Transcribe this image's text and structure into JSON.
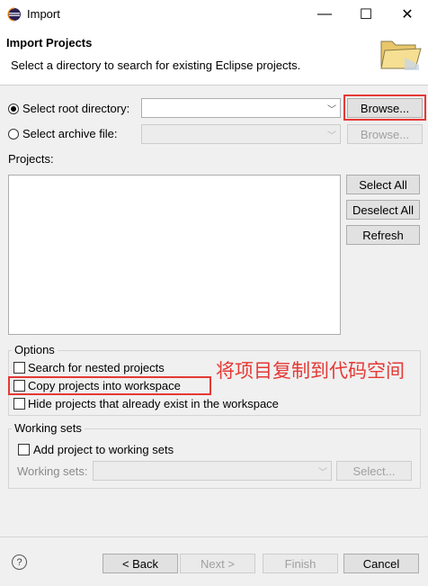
{
  "window": {
    "title": "Import",
    "minimize_glyph": "—",
    "maximize_glyph": "☐",
    "close_glyph": "✕"
  },
  "header": {
    "title": "Import Projects",
    "description": "Select a directory to search for existing Eclipse projects."
  },
  "source": {
    "root_dir_label": "Select root directory:",
    "root_dir_value": "",
    "archive_label": "Select archive file:",
    "archive_value": "",
    "browse_label": "Browse...",
    "browse_archive_label": "Browse..."
  },
  "projects": {
    "label": "Projects:",
    "items": [],
    "select_all": "Select All",
    "deselect_all": "Deselect All",
    "refresh": "Refresh"
  },
  "options": {
    "title": "Options",
    "search_nested": "Search for nested projects",
    "copy_into_workspace": "Copy projects into workspace",
    "hide_existing": "Hide projects that already exist in the workspace"
  },
  "annotation": {
    "text": "将项目复制到代码空间"
  },
  "working_sets": {
    "title": "Working sets",
    "add_label": "Add project to working sets",
    "sets_label": "Working sets:",
    "sets_value": "",
    "select_label": "Select..."
  },
  "footer": {
    "help": "?",
    "back": "< Back",
    "next": "Next >",
    "finish": "Finish",
    "cancel": "Cancel"
  },
  "colors": {
    "annotation_red": "#e53935",
    "dialog_bg": "#f0f0f0"
  }
}
